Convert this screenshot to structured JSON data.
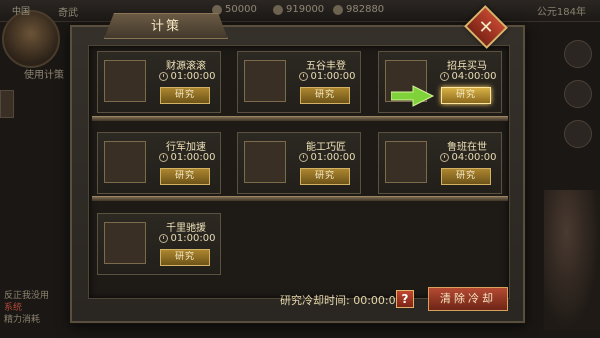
{
  "background": {
    "ribbon_label": "中国",
    "resources": [
      "奇武",
      "50000",
      "919000",
      "982880"
    ],
    "year": "公元184年",
    "left_button": "使用计策",
    "chat_lines": [
      "反正我没用",
      "系统",
      "精力消耗"
    ]
  },
  "dialog": {
    "title": "计策",
    "close_icon": "close-x-icon"
  },
  "techs": [
    {
      "name": "财源滚滚",
      "time": "01:00:00",
      "button": "研究",
      "icon": "gold-treasure-thumb"
    },
    {
      "name": "五谷丰登",
      "time": "01:00:00",
      "button": "研究",
      "icon": "grain-sack-thumb"
    },
    {
      "name": "招兵买马",
      "time": "04:00:00",
      "button": "研究",
      "icon": "recruit-soldiers-thumb"
    },
    {
      "name": "行军加速",
      "time": "01:00:00",
      "button": "研究",
      "icon": "march-army-thumb"
    },
    {
      "name": "能工巧匠",
      "time": "01:00:00",
      "button": "研究",
      "icon": "craftsman-thumb"
    },
    {
      "name": "鲁班在世",
      "time": "04:00:00",
      "button": "研究",
      "icon": "workshop-thumb"
    },
    {
      "name": "千里驰援",
      "time": "01:00:00",
      "button": "研究",
      "icon": "rescue-thumb"
    }
  ],
  "footer": {
    "cooldown_label": "研究冷却时间:",
    "cooldown_value": "00:00:00",
    "help_label": "?",
    "clear_label": "清除冷却"
  },
  "colors": {
    "accent_gold": "#d8b144",
    "danger_red": "#c24630",
    "text_cream": "#f0e2b8"
  }
}
